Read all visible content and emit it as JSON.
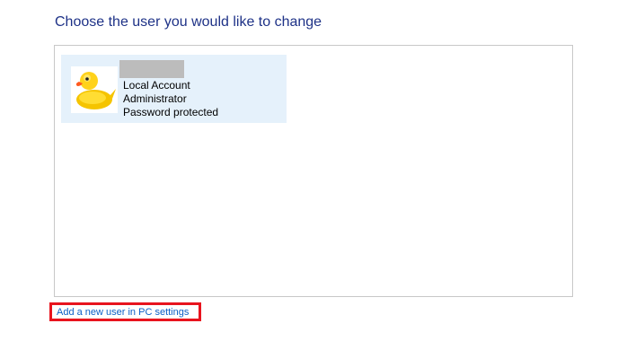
{
  "page": {
    "title": "Choose the user you would like to change"
  },
  "users": [
    {
      "avatar_icon": "rubber-duck-icon",
      "details": [
        "Local Account",
        "Administrator",
        "Password protected"
      ]
    }
  ],
  "links": {
    "add_user": "Add a new user in PC settings"
  },
  "colors": {
    "title_text": "#1e3287",
    "link_text": "#0b5fc6",
    "tile_background": "#e5f1fb",
    "highlight_border": "#e8141e",
    "redaction": "#bcbcbc"
  }
}
